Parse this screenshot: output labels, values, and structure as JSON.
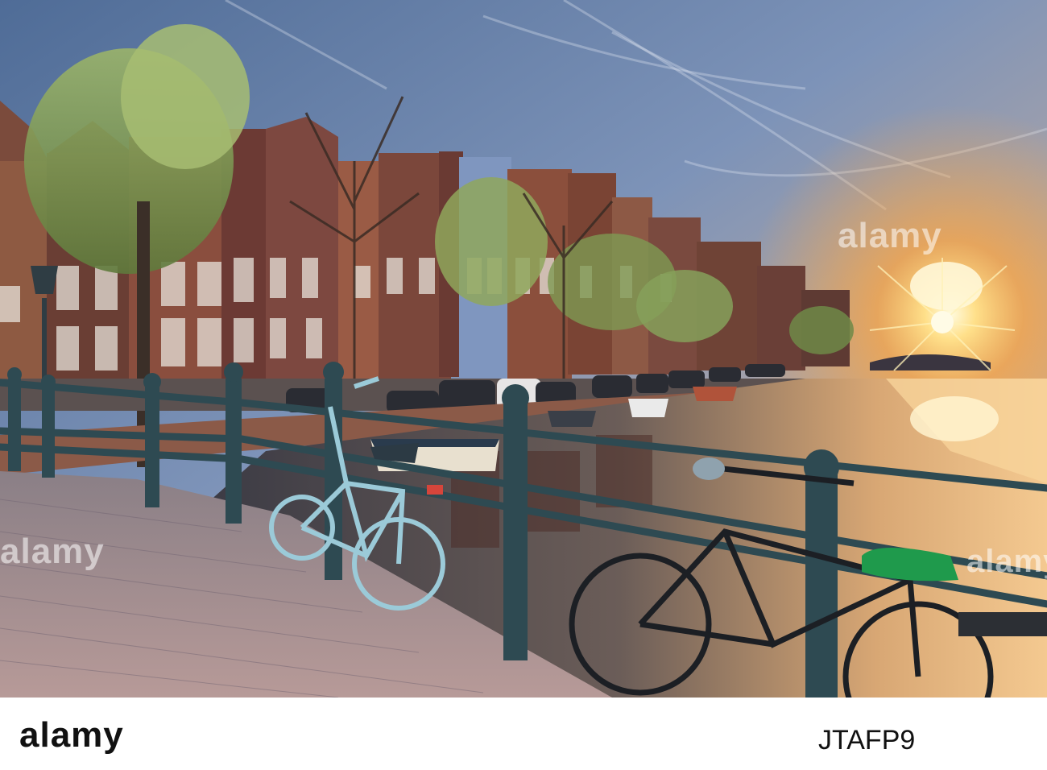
{
  "photo": {
    "description_icon": "amsterdam-canal-sunrise-photo"
  },
  "watermark": {
    "text": "alamy"
  },
  "footer": {
    "logo": "alamy",
    "image_id": "JTAFP9"
  }
}
